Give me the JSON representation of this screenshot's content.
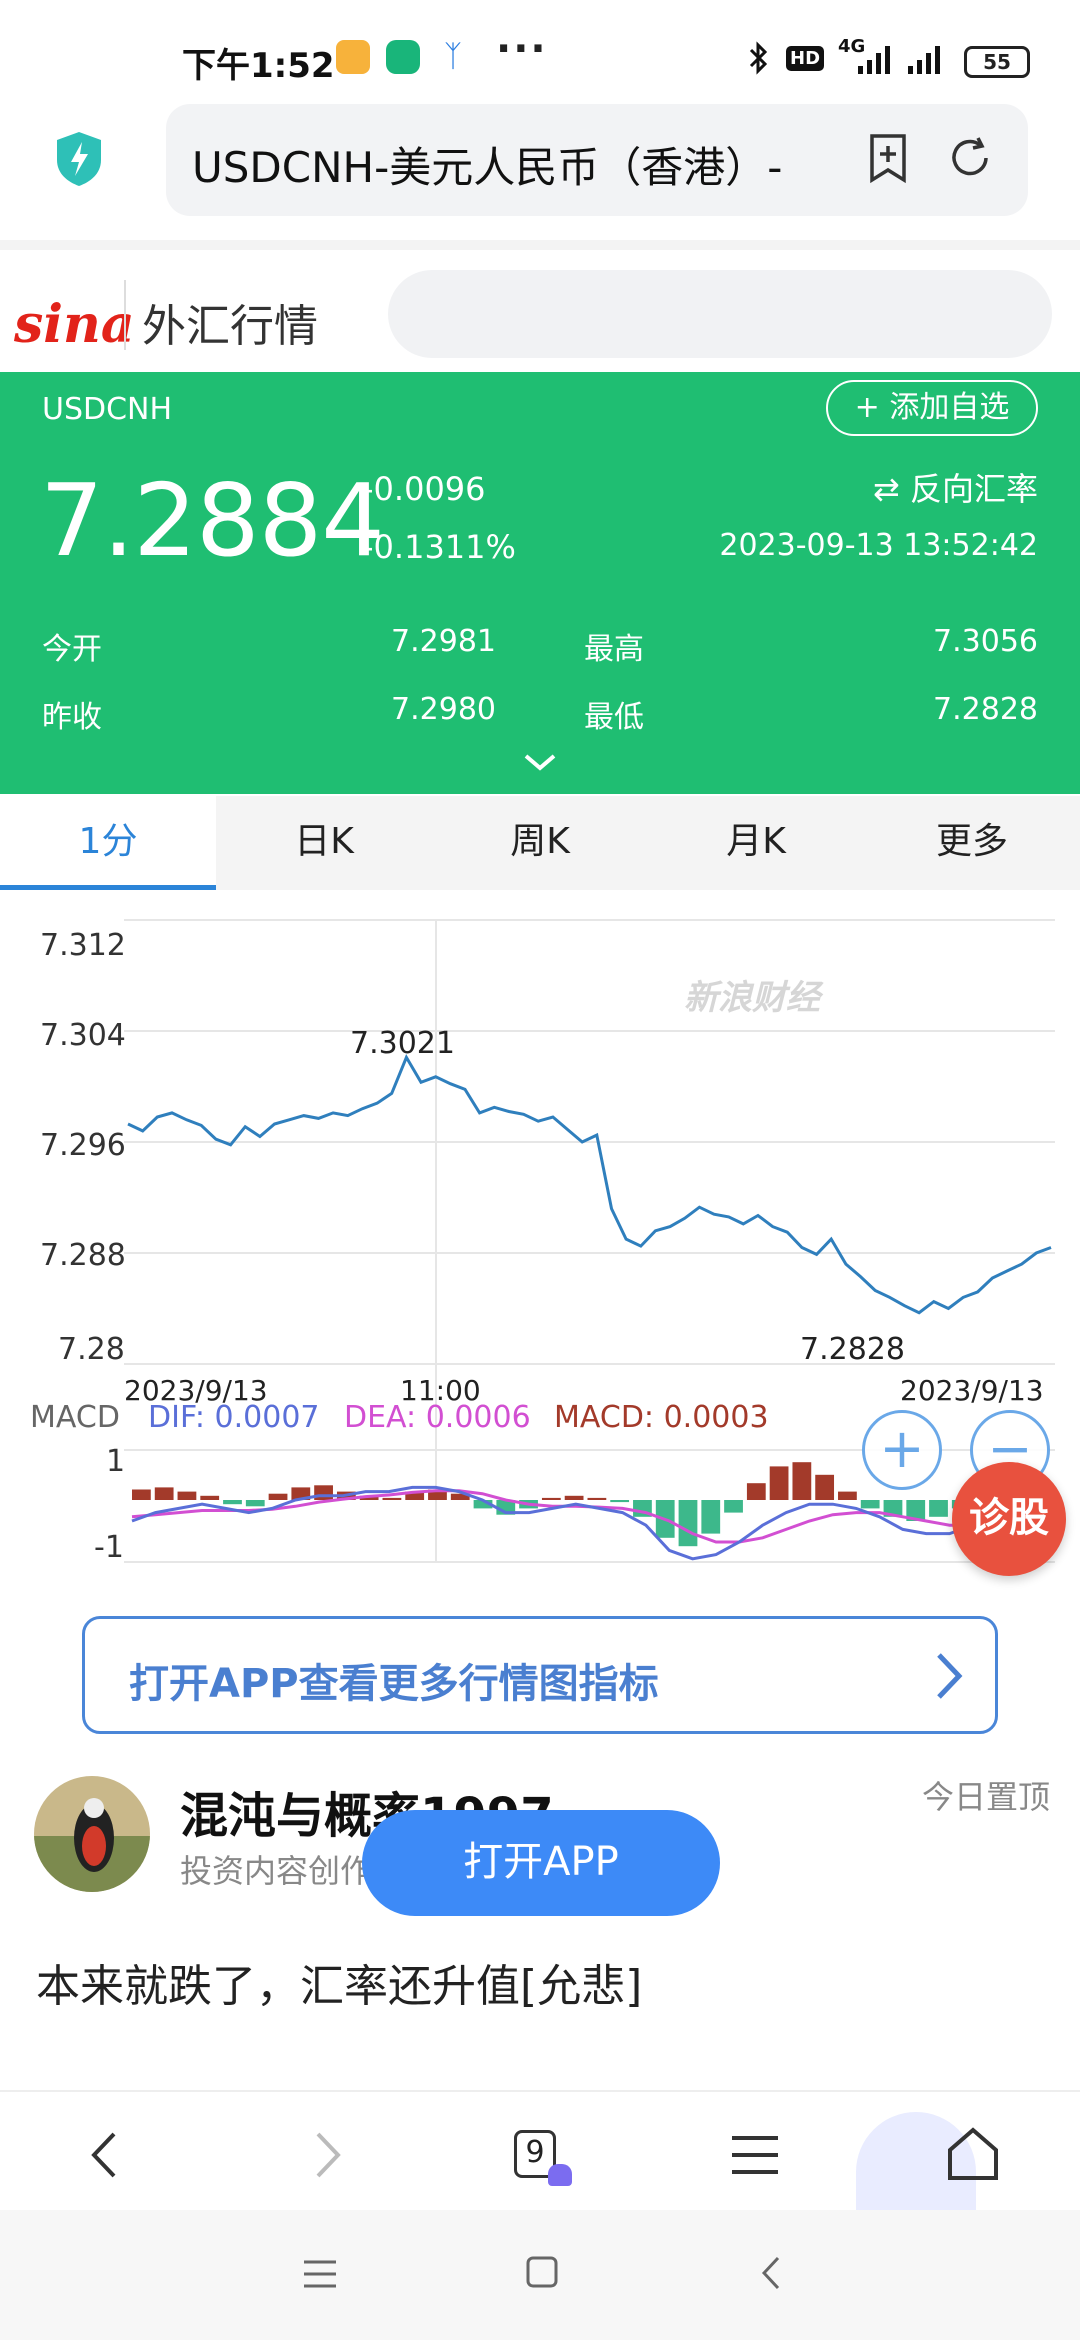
{
  "status_bar": {
    "time": "下午1:52",
    "more": "···",
    "hd": "HD",
    "network": "4G",
    "battery": "55"
  },
  "browser": {
    "url_text": "USDCNH-美元人民币（香港）-",
    "tab_count": "9"
  },
  "site": {
    "logo": "sina",
    "section_title": "外汇行情"
  },
  "quote": {
    "symbol": "USDCNH",
    "add_watchlist": "+ 添加自选",
    "price": "7.2884",
    "change": "-0.0096",
    "change_pct": "-0.1311%",
    "reverse_rate": "⇄ 反向汇率",
    "timestamp": "2023-09-13 13:52:42",
    "open_label": "今开",
    "open_value": "7.2981",
    "high_label": "最高",
    "high_value": "7.3056",
    "prev_close_label": "昨收",
    "prev_close_value": "7.2980",
    "low_label": "最低",
    "low_value": "7.2828",
    "accent_color": "#1fbe72"
  },
  "tabs": [
    {
      "label": "1分",
      "active": true
    },
    {
      "label": "日K",
      "active": false
    },
    {
      "label": "周K",
      "active": false
    },
    {
      "label": "月K",
      "active": false
    },
    {
      "label": "更多",
      "active": false
    }
  ],
  "chart_data": {
    "type": "line",
    "watermark": "新浪财经",
    "y_ticks": [
      "7.312",
      "7.304",
      "7.296",
      "7.288",
      "7.28"
    ],
    "ylim": [
      7.28,
      7.312
    ],
    "x_ticks": [
      "2023/9/13",
      "11:00",
      "2023/9/13"
    ],
    "annotations": {
      "high": "7.3021",
      "low": "7.2828"
    },
    "series": [
      {
        "values": [
          7.2973,
          7.2968,
          7.2978,
          7.2981,
          7.2976,
          7.2972,
          7.2962,
          7.2958,
          7.2971,
          7.2964,
          7.2973,
          7.2976,
          7.2979,
          7.2977,
          7.2981,
          7.2979,
          7.2984,
          7.2988,
          7.2995,
          7.3021,
          7.3003,
          7.3007,
          7.3002,
          7.2998,
          7.2981,
          7.2985,
          7.2982,
          7.298,
          7.2975,
          7.2978,
          7.2969,
          7.296,
          7.2965,
          7.2912,
          7.289,
          7.2885,
          7.2896,
          7.2899,
          7.2905,
          7.2913,
          7.2908,
          7.2906,
          7.2901,
          7.2907,
          7.2899,
          7.2895,
          7.2884,
          7.2879,
          7.289,
          7.2872,
          7.2863,
          7.2853,
          7.2848,
          7.2842,
          7.2837,
          7.2845,
          7.284,
          7.2848,
          7.2852,
          7.2862,
          7.2867,
          7.2872,
          7.288,
          7.2884
        ]
      }
    ]
  },
  "macd": {
    "label": "MACD",
    "dif": "DIF: 0.0007",
    "dea": "DEA: 0.0006",
    "macd": "MACD: 0.0003",
    "y_top": "1",
    "y_bottom": "-1",
    "dif_color": "#5a6fd8",
    "dea_color": "#d24fd2",
    "macd_color": "#a33a2a",
    "histogram": [
      0.25,
      0.3,
      0.2,
      0.1,
      -0.1,
      -0.15,
      0.15,
      0.3,
      0.35,
      0.2,
      0.1,
      0.05,
      0.2,
      0.25,
      0.15,
      -0.2,
      -0.35,
      -0.2,
      0.05,
      0.1,
      0.05,
      -0.05,
      -0.4,
      -0.9,
      -1.1,
      -0.8,
      -0.3,
      0.4,
      0.8,
      0.9,
      0.6,
      0.2,
      -0.2,
      -0.4,
      -0.5,
      -0.4,
      -0.2,
      0.1,
      0.3,
      0.2
    ],
    "dif_values": [
      -0.5,
      -0.3,
      -0.2,
      -0.1,
      -0.2,
      -0.3,
      -0.2,
      0.0,
      0.1,
      0.1,
      0.2,
      0.2,
      0.3,
      0.3,
      0.2,
      0.0,
      -0.3,
      -0.3,
      -0.2,
      -0.1,
      -0.2,
      -0.3,
      -0.6,
      -1.2,
      -1.4,
      -1.3,
      -1.0,
      -0.6,
      -0.3,
      -0.1,
      -0.1,
      -0.2,
      -0.4,
      -0.7,
      -0.8,
      -0.8,
      -0.6,
      -0.4,
      -0.2,
      0.0
    ],
    "dea_values": [
      -0.4,
      -0.35,
      -0.3,
      -0.25,
      -0.25,
      -0.25,
      -0.22,
      -0.15,
      -0.05,
      0.02,
      0.08,
      0.12,
      0.18,
      0.22,
      0.22,
      0.15,
      0.0,
      -0.1,
      -0.15,
      -0.15,
      -0.17,
      -0.2,
      -0.3,
      -0.5,
      -0.8,
      -1.0,
      -1.0,
      -0.9,
      -0.7,
      -0.5,
      -0.35,
      -0.3,
      -0.3,
      -0.4,
      -0.5,
      -0.6,
      -0.6,
      -0.55,
      -0.45,
      -0.3
    ]
  },
  "zoom": {
    "in": "+",
    "out": "−"
  },
  "diagnose_button": "诊股",
  "open_banner": "打开APP查看更多行情图指标",
  "post": {
    "username": "混沌与概率1997",
    "subtitle": "投资内容创作者",
    "pinned": "今日置顶",
    "open_app": "打开APP",
    "text": "本来就跌了，汇率还升值[允悲]"
  }
}
